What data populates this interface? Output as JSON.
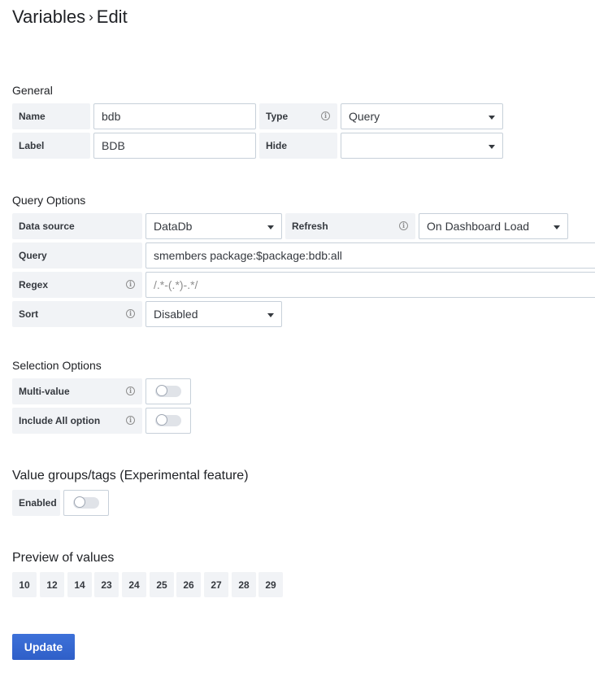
{
  "header": {
    "title": "Variables",
    "separator": "›",
    "subtitle": "Edit"
  },
  "general": {
    "title": "General",
    "name_label": "Name",
    "name_value": "bdb",
    "type_label": "Type",
    "type_value": "Query",
    "label_label": "Label",
    "label_value": "BDB",
    "hide_label": "Hide",
    "hide_value": ""
  },
  "query_options": {
    "title": "Query Options",
    "datasource_label": "Data source",
    "datasource_value": "DataDb",
    "refresh_label": "Refresh",
    "refresh_value": "On Dashboard Load",
    "query_label": "Query",
    "query_value": "smembers package:$package:bdb:all",
    "regex_label": "Regex",
    "regex_placeholder": "/.*-(.*)-.*/",
    "sort_label": "Sort",
    "sort_value": "Disabled"
  },
  "selection_options": {
    "title": "Selection Options",
    "multi_value_label": "Multi-value",
    "multi_value_on": false,
    "include_all_label": "Include All option",
    "include_all_on": false
  },
  "value_groups": {
    "title": "Value groups/tags (Experimental feature)",
    "enabled_label": "Enabled",
    "enabled_on": false
  },
  "preview": {
    "title": "Preview of values",
    "values": [
      "10",
      "12",
      "14",
      "23",
      "24",
      "25",
      "26",
      "27",
      "28",
      "29"
    ]
  },
  "actions": {
    "update_label": "Update"
  },
  "icons": {
    "info": "info-circle-icon",
    "dropdown": "caret-down-icon"
  },
  "colors": {
    "accent": "#3871dc",
    "label_bg": "#f1f3f6",
    "border": "#c7d0d9"
  }
}
